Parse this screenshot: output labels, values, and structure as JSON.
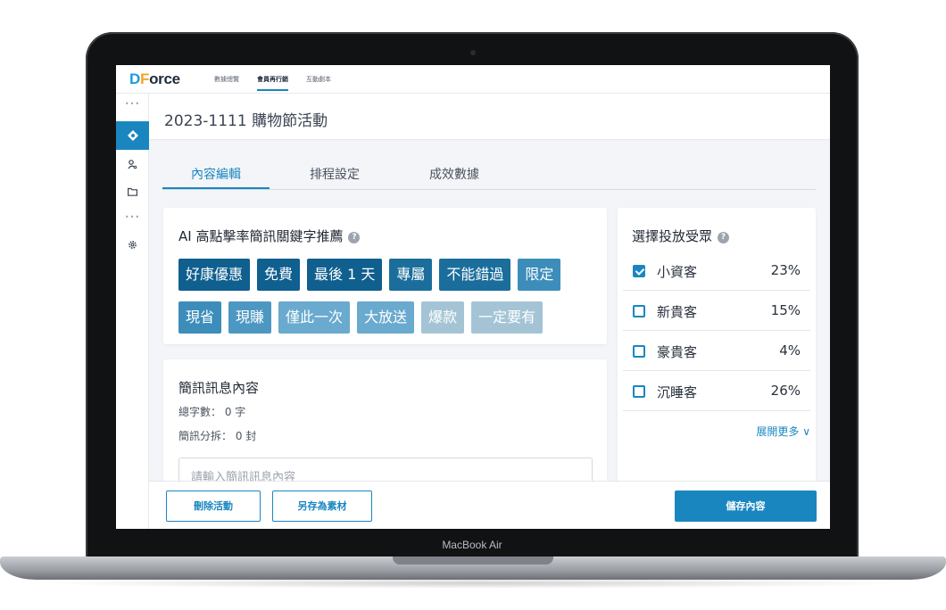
{
  "app": {
    "logo": {
      "d": "D",
      "f": "F",
      "rest": "orce"
    },
    "nav": [
      "數據總覽",
      "會員再行銷",
      "互動劇本"
    ],
    "active_nav": 1
  },
  "sidebar": {
    "icons": [
      "more-icon",
      "compass-icon",
      "user-search-icon",
      "folder-icon",
      "more-icon",
      "gear-icon"
    ],
    "active_index": 1
  },
  "page_title": "2023-1111 購物節活動",
  "tabs": [
    "內容編輯",
    "排程設定",
    "成效數據"
  ],
  "active_tab": 0,
  "keywords": {
    "title": "AI 高點擊率簡訊關鍵字推薦",
    "help": "?",
    "row1": [
      {
        "label": "好康優惠",
        "color": "#0f5f8f"
      },
      {
        "label": "免費",
        "color": "#0f5f8f"
      },
      {
        "label": "最後 1 天",
        "color": "#0f5f8f"
      },
      {
        "label": "專屬",
        "color": "#1b6e9c"
      },
      {
        "label": "不能錯過",
        "color": "#1b6e9c"
      },
      {
        "label": "限定",
        "color": "#3d8dbb"
      }
    ],
    "row2": [
      {
        "label": "現省",
        "color": "#3d8dbb"
      },
      {
        "label": "現賺",
        "color": "#4d98c3"
      },
      {
        "label": "僅此一次",
        "color": "#6aaace"
      },
      {
        "label": "大放送",
        "color": "#6aaace"
      },
      {
        "label": "爆款",
        "color": "#a4c4d6"
      },
      {
        "label": "一定要有",
        "color": "#a4c4d6"
      }
    ]
  },
  "sms": {
    "title": "簡訊訊息內容",
    "char_count": "總字數： 0 字",
    "split_count": "簡訊分拆： 0 封",
    "placeholder": "請輸入簡訊訊息內容"
  },
  "audience": {
    "title": "選擇投放受眾",
    "help": "?",
    "rows": [
      {
        "name": "小資客",
        "pct": "23%",
        "checked": true
      },
      {
        "name": "新貴客",
        "pct": "15%",
        "checked": false
      },
      {
        "name": "豪貴客",
        "pct": "4%",
        "checked": false
      },
      {
        "name": "沉睡客",
        "pct": "26%",
        "checked": false
      }
    ],
    "expand": "展開更多 ∨"
  },
  "footer": {
    "delete": "刪除活動",
    "save_as": "另存為素材",
    "save": "儲存內容"
  },
  "device_label": "MacBook Air",
  "colors": {
    "accent": "#1a86c0"
  }
}
